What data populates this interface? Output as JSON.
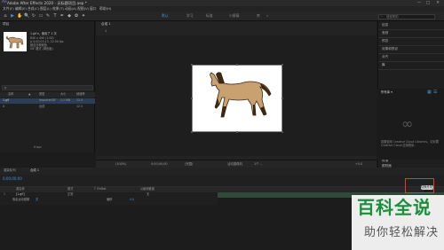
{
  "window": {
    "title": "Adobe After Effects 2020 - 无标题项目.aep *",
    "controls": [
      "—",
      "□",
      "✕"
    ]
  },
  "menu": [
    "文件(F)",
    "编辑(E)",
    "合成(C)",
    "图层(L)",
    "效果(T)",
    "动画(A)",
    "视图(V)",
    "窗口",
    "帮助(H)"
  ],
  "toolbar": {
    "tools": [
      "⌂",
      "▶",
      "✋",
      "🔍",
      "↻",
      "▭",
      "✎",
      "T",
      "✒",
      "◆",
      "✿",
      "✦"
    ],
    "workspaces": [
      "默认",
      "学习",
      "标准",
      "小屏幕",
      "库"
    ],
    "search_placeholder": "搜索帮助"
  },
  "project": {
    "tab": "项目",
    "comp_name": "1.gif ▾，使用了 1 次",
    "meta": [
      "840 x 490 (1.00)",
      "Δ 0;00;03;13, 12.50 fps",
      "数百万种颜色",
      "GIF 格式 (调色板)"
    ],
    "search_icon_text": "ρ",
    "columns": [
      "名称",
      "▲",
      "类型",
      "大小",
      "帧速率"
    ],
    "rows": [
      {
        "name": "1.gif",
        "type": "ImporterGIF",
        "size": "1.1 MB",
        "fps": "12.5"
      },
      {
        "name": "1",
        "type": "合成",
        "size": "",
        "fps": "12.5"
      }
    ],
    "bpc": "8 bpc"
  },
  "viewer": {
    "tab": "合成 1",
    "breadcrumb": "1",
    "controls": [
      "(100%)",
      "0;00;00;00",
      "(完整)",
      "活动摄像机",
      "1个...",
      "+0.0"
    ]
  },
  "right_panels": [
    "信息",
    "音频",
    "预览",
    "效果和预设",
    "对齐",
    "库",
    "字符",
    "段落",
    "跟踪器",
    "内容识别填充"
  ],
  "libraries": {
    "title": "所有库 ▾",
    "message": "若要使用 Creative Cloud Libraries，请安装 Creative Cloud 应用程序。"
  },
  "timeline": {
    "tabs": [
      "渲染队列",
      "合成 1"
    ],
    "timecode": "0;00;00;00",
    "columns": [
      "源名称",
      "模式",
      "T  TrkMat",
      "父级和链接"
    ],
    "layer": {
      "index": "1",
      "name": "[1.gif]",
      "mode": "正常",
      "parent": "无"
    },
    "props": [
      {
        "label": "像素运动模糊",
        "value": "关"
      },
      {
        "label": "偏移",
        "value": "0.0"
      }
    ],
    "switch_button": "切换开关/模式"
  },
  "watermark": {
    "line1": "百科全说",
    "line2": "助你轻松解决"
  }
}
